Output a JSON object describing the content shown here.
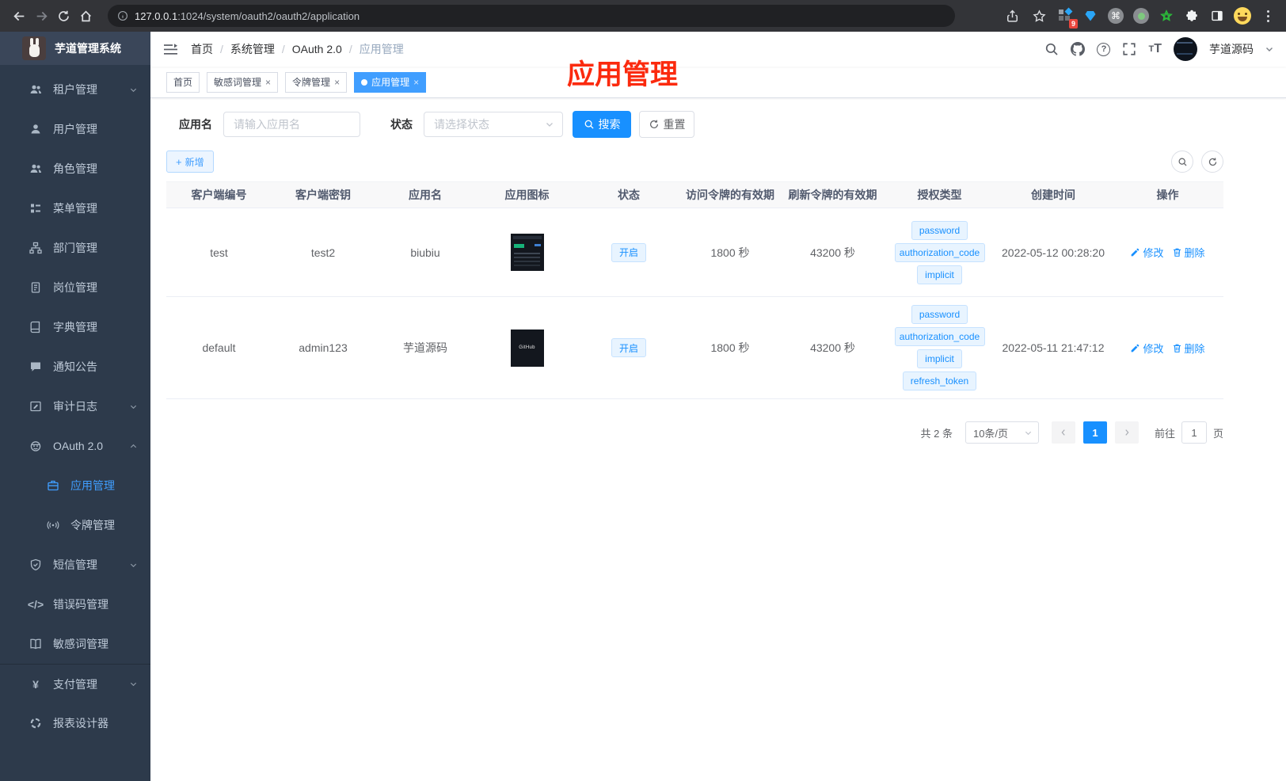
{
  "colors": {
    "primary": "#1890ff",
    "tab_active": "#409eff",
    "sidebar_bg": "#2d3a4b",
    "annotation": "#fb2a0e"
  },
  "browser": {
    "url_host": "127.0.0.1",
    "url_path": ":1024/system/oauth2/oauth2/application",
    "extension_badge": "9"
  },
  "sidebar": {
    "logo_title": "芋道管理系统",
    "items": [
      {
        "id": "tenant",
        "label": "租户管理",
        "icon": "users",
        "arrow": "down"
      },
      {
        "id": "user",
        "label": "用户管理",
        "icon": "user"
      },
      {
        "id": "role",
        "label": "角色管理",
        "icon": "users"
      },
      {
        "id": "menu",
        "label": "菜单管理",
        "icon": "tree"
      },
      {
        "id": "dept",
        "label": "部门管理",
        "icon": "org"
      },
      {
        "id": "post",
        "label": "岗位管理",
        "icon": "post"
      },
      {
        "id": "dict",
        "label": "字典管理",
        "icon": "dict"
      },
      {
        "id": "notice",
        "label": "通知公告",
        "icon": "notice"
      },
      {
        "id": "audit-log",
        "label": "审计日志",
        "icon": "log",
        "arrow": "down"
      },
      {
        "id": "oauth2",
        "label": "OAuth 2.0",
        "icon": "robot",
        "arrow": "up"
      },
      {
        "id": "oauth2-application",
        "label": "应用管理",
        "icon": "app",
        "child": true,
        "active": true
      },
      {
        "id": "oauth2-token",
        "label": "令牌管理",
        "icon": "token",
        "child": true
      },
      {
        "id": "sms",
        "label": "短信管理",
        "icon": "shield",
        "arrow": "down"
      },
      {
        "id": "error-code",
        "label": "错误码管理",
        "icon": "code"
      },
      {
        "id": "sensitive-word",
        "label": "敏感词管理",
        "icon": "book"
      },
      {
        "id": "pay",
        "label": "支付管理",
        "icon": "yen",
        "arrow": "down",
        "section": true
      },
      {
        "id": "report-designer",
        "label": "报表设计器",
        "icon": "report"
      }
    ]
  },
  "navbar": {
    "breadcrumb": [
      "首页",
      "系统管理",
      "OAuth 2.0",
      "应用管理"
    ],
    "breadcrumb_separator": "/",
    "username": "芋道源码"
  },
  "tags_view": [
    {
      "label": "首页",
      "closable": false,
      "active": false
    },
    {
      "label": "敏感词管理",
      "closable": true,
      "active": false
    },
    {
      "label": "令牌管理",
      "closable": true,
      "active": false
    },
    {
      "label": "应用管理",
      "closable": true,
      "active": true
    }
  ],
  "annotation_text": "应用管理",
  "filters": {
    "app_name_label": "应用名",
    "app_name_placeholder": "请输入应用名",
    "status_label": "状态",
    "status_placeholder": "请选择状态",
    "search_label": "搜索",
    "reset_label": "重置"
  },
  "toolbar": {
    "add_label": "新增"
  },
  "table": {
    "columns": [
      "客户端编号",
      "客户端密钥",
      "应用名",
      "应用图标",
      "状态",
      "访问令牌的有效期",
      "刷新令牌的有效期",
      "授权类型",
      "创建时间",
      "操作"
    ],
    "edit_label": "修改",
    "delete_label": "删除",
    "rows": [
      {
        "client_id": "test",
        "secret": "test2",
        "name": "biubiu",
        "icon": "dark-screenshot",
        "icon_text": "",
        "status": "开启",
        "access_validity": "1800 秒",
        "refresh_validity": "43200 秒",
        "grant_types": [
          "password",
          "authorization_code",
          "implicit"
        ],
        "created": "2022-05-12 00:28:20"
      },
      {
        "client_id": "default",
        "secret": "admin123",
        "name": "芋道源码",
        "icon": "github",
        "icon_text": "GitHub",
        "status": "开启",
        "access_validity": "1800 秒",
        "refresh_validity": "43200 秒",
        "grant_types": [
          "password",
          "authorization_code",
          "implicit",
          "refresh_token"
        ],
        "created": "2022-05-11 21:47:12"
      }
    ]
  },
  "pagination": {
    "total": "共 2 条",
    "page_size": "10条/页",
    "current": "1",
    "goto_label": "前往",
    "goto_value": "1",
    "page_label": "页"
  }
}
